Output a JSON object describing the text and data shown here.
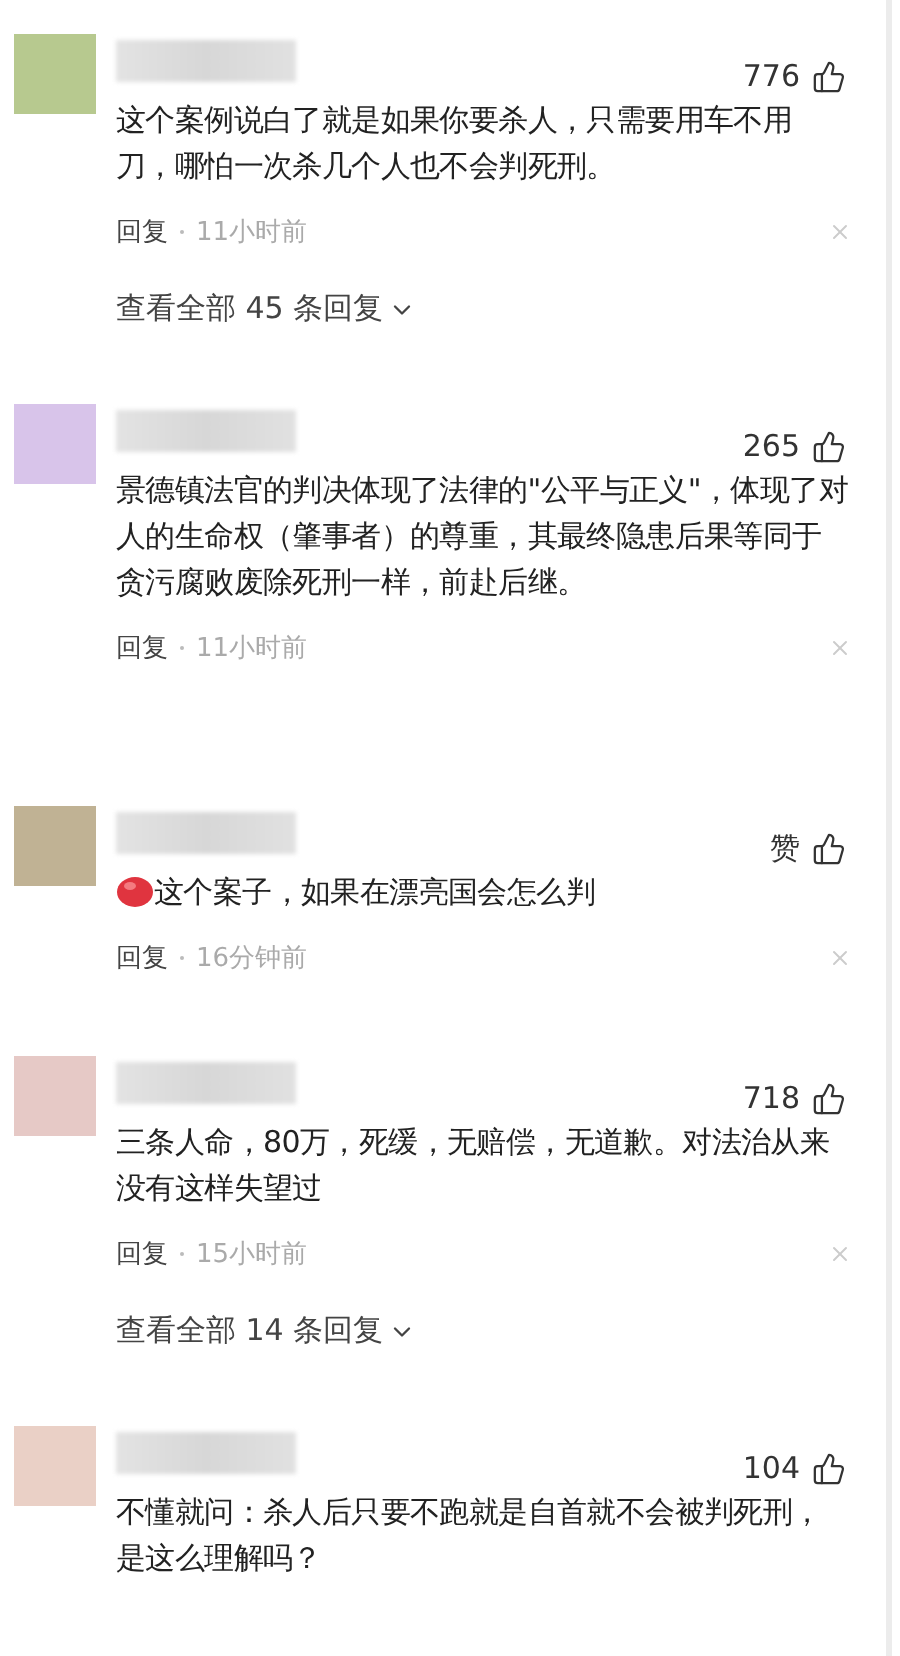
{
  "comments": [
    {
      "color": "#b7c98f",
      "likes": "776",
      "text": "这个案例说白了就是如果你要杀人，只需要用车不用刀，哪怕一次杀几个人也不会判死刑。",
      "has_emoji": false,
      "reply": "回复",
      "time": "11小时前",
      "view_replies": "查看全部 45 条回复"
    },
    {
      "color": "#d8c4ea",
      "likes": "265",
      "text": "景德镇法官的判决体现了法律的\"公平与正义\"，体现了对人的生命权（肇事者）的尊重，其最终隐患后果等同于贪污腐败废除死刑一样，前赴后继。",
      "has_emoji": false,
      "reply": "回复",
      "time": "11小时前"
    },
    {
      "color": "#c0b294",
      "likes": "赞",
      "text": "这个案子，如果在漂亮国会怎么判",
      "has_emoji": true,
      "reply": "回复",
      "time": "16分钟前"
    },
    {
      "color": "#e6c9c6",
      "likes": "718",
      "text": "三条人命，80万，死缓，无赔偿，无道歉。对法治从来没有这样失望过",
      "has_emoji": false,
      "reply": "回复",
      "time": "15小时前",
      "view_replies": "查看全部 14 条回复"
    },
    {
      "color": "#ead0c6",
      "likes": "104",
      "text": "不懂就问：杀人后只要不跑就是自首就不会被判死刑，是这么理解吗？",
      "has_emoji": false
    }
  ]
}
